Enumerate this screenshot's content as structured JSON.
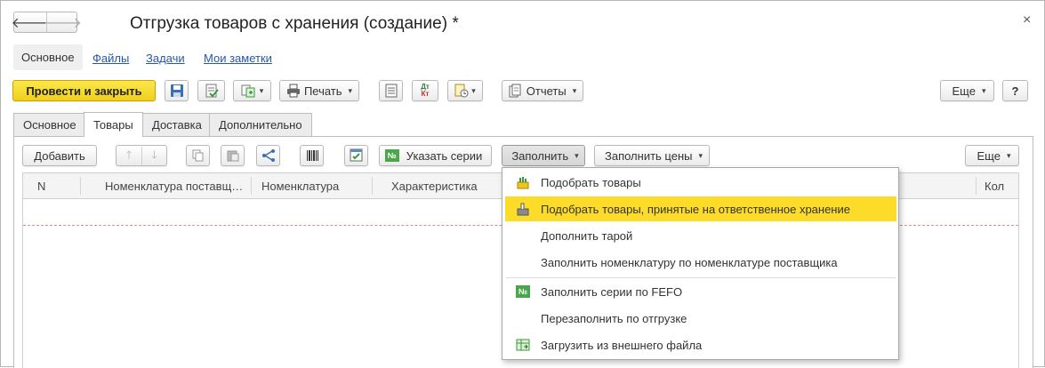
{
  "window": {
    "title": "Отгрузка товаров с хранения (создание) *",
    "back_glyph": "🡐",
    "forward_glyph": "🡒",
    "close_glyph": "×"
  },
  "sections": [
    {
      "label": "Основное"
    },
    {
      "label": "Файлы"
    },
    {
      "label": "Задачи"
    },
    {
      "label": "Мои заметки"
    }
  ],
  "toolbar": {
    "post_close": "Провести и закрыть",
    "print": "Печать",
    "dtkt_top": "Дт",
    "dtkt_bottom": "Кт",
    "reports": "Отчеты",
    "more": "Еще",
    "help": "?"
  },
  "tabs": [
    {
      "label": "Основное"
    },
    {
      "label": "Товары"
    },
    {
      "label": "Доставка"
    },
    {
      "label": "Дополнительно"
    }
  ],
  "goods_toolbar": {
    "add": "Добавить",
    "specify_series": "Указать серии",
    "fill": "Заполнить",
    "fill_prices": "Заполнить цены",
    "more": "Еще"
  },
  "grid": {
    "columns": [
      "N",
      "Номенклатура поставщ…",
      "Номенклатура",
      "Характеристика",
      "Кол"
    ]
  },
  "fill_menu": {
    "items": [
      {
        "label": "Подобрать товары",
        "icon": "pick-goods-icon"
      },
      {
        "label": "Подобрать товары, принятые на ответственное хранение",
        "icon": "pick-stored-goods-icon",
        "highlighted": true
      },
      {
        "label": "Дополнить тарой",
        "icon": ""
      },
      {
        "label": "Заполнить номенклатуру по номенклатуре поставщика",
        "icon": ""
      },
      {
        "label": "Заполнить серии по FEFO",
        "icon": "series-icon"
      },
      {
        "label": "Перезаполнить по отгрузке",
        "icon": ""
      },
      {
        "label": "Загрузить из внешнего файла",
        "icon": "load-file-icon"
      }
    ]
  },
  "colors": {
    "accent_yellow": "#fcdc29",
    "link_blue": "#2856a8",
    "green_icon": "#4aa64a"
  }
}
